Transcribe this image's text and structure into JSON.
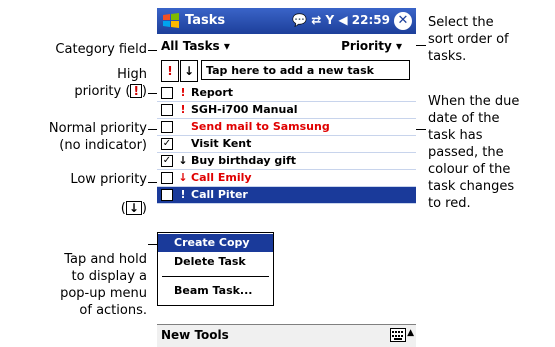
{
  "window": {
    "title": "Tasks",
    "time": "22:59",
    "close_glyph": "✕"
  },
  "category": {
    "label": "All Tasks",
    "sort_label": "Priority"
  },
  "new_task": {
    "high_btn": "!",
    "low_btn": "↓",
    "placeholder": "Tap here to add a new task"
  },
  "tasks": [
    {
      "name": "Report",
      "priority": "!",
      "checked": false,
      "overdue": false
    },
    {
      "name": "SGH-i700 Manual",
      "priority": "!",
      "checked": false,
      "overdue": false
    },
    {
      "name": "Send mail to Samsung",
      "priority": "",
      "checked": false,
      "overdue": true
    },
    {
      "name": "Visit Kent",
      "priority": "",
      "checked": true,
      "overdue": false
    },
    {
      "name": "Buy birthday gift",
      "priority": "↓",
      "checked": true,
      "overdue": false
    },
    {
      "name": "Call Emily",
      "priority": "↓",
      "checked": false,
      "overdue": true
    },
    {
      "name": "Call Piter",
      "priority": "!",
      "checked": false,
      "overdue": false,
      "selected": true
    }
  ],
  "popup_menu": {
    "items": [
      "Create Copy",
      "Delete Task",
      "Beam Task..."
    ]
  },
  "menubar": {
    "new_label": "New",
    "tools_label": "Tools"
  },
  "callouts": {
    "category": "Category field",
    "high_line1": "High",
    "high_line2": "priority (",
    "high_glyph": "!",
    "high_close": ")",
    "normal_line1": "Normal priority",
    "normal_line2": "(no indicator)",
    "low_line1": "Low priority",
    "low_open": "(",
    "low_glyph": "↓",
    "low_close": ")",
    "tap_line1": "Tap and hold",
    "tap_line2": "to display a",
    "tap_line3": "pop-up menu",
    "tap_line4": "of actions.",
    "sort_line1": "Select the",
    "sort_line2": "sort order of",
    "sort_line3": "tasks.",
    "due_line1": "When the due",
    "due_line2": "date of the",
    "due_line3": "task has",
    "due_line4": "passed, the",
    "due_line5": "colour of the",
    "due_line6": "task changes",
    "due_line7": "to red."
  },
  "colors": {
    "titlebar": "#1d3f9a",
    "overdue": "#e00000",
    "selection": "#1a3a9a",
    "high_priority": "#d00000"
  }
}
